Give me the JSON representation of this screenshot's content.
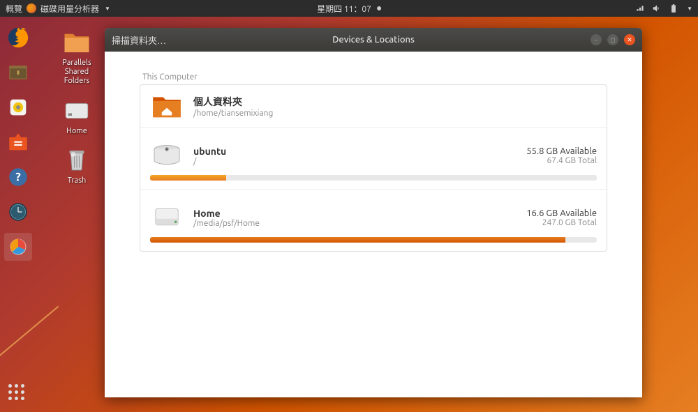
{
  "topbar": {
    "activities": "概覽",
    "app_name": "磁碟用量分析器",
    "datetime": "星期四 11：07"
  },
  "desktop": {
    "parallels": "Parallels\nShared\nFolders",
    "home": "Home",
    "trash": "Trash"
  },
  "window": {
    "scan_folder": "掃描資料夾…",
    "title": "Devices & Locations",
    "section": "This Computer",
    "home_folder": {
      "name": "個人資料夾",
      "path": "/home/tiansemixiang"
    },
    "volumes": [
      {
        "name": "ubuntu",
        "path": "/",
        "available": "55.8 GB Available",
        "total": "67.4 GB Total",
        "used_pct": 17
      },
      {
        "name": "Home",
        "path": "/media/psf/Home",
        "available": "16.6 GB Available",
        "total": "247.0 GB Total",
        "used_pct": 93
      }
    ]
  }
}
